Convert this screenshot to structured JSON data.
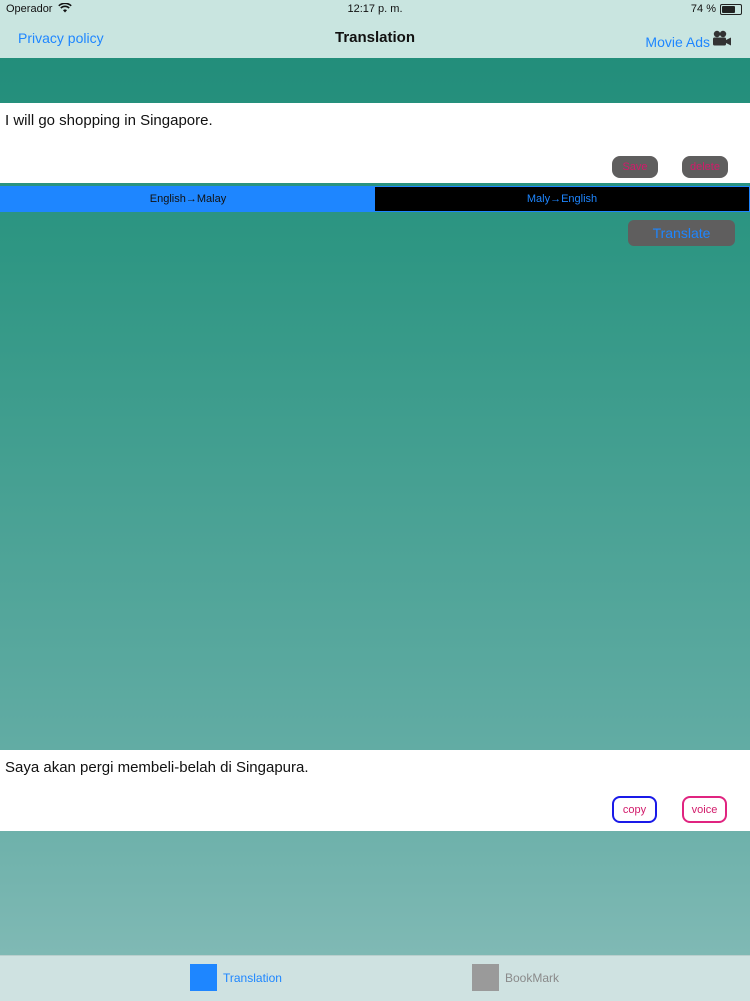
{
  "status": {
    "carrier": "Operador",
    "time": "12:17 p. m.",
    "battery": "74 %",
    "battery_level": 0.74
  },
  "nav": {
    "left_link": "Privacy policy",
    "title": "Translation",
    "right_link": "Movie Ads",
    "right_icon": "movie-camera-icon"
  },
  "input": {
    "text": "I will go shopping in Singapore.",
    "save_label": "Save",
    "delete_label": "delete"
  },
  "direction": {
    "options": [
      "English→Malay",
      "Maly→English"
    ],
    "selected": 0
  },
  "translate_label": "Translate",
  "output": {
    "text": "Saya akan pergi membeli-belah di Singapura.",
    "copy_label": "copy",
    "voice_label": "voice"
  },
  "tabs": [
    {
      "label": "Translation",
      "active": true
    },
    {
      "label": "BookMark",
      "active": false
    }
  ],
  "colors": {
    "accent": "#1e86ff",
    "header_bg": "#c9e5e0",
    "pink": "#d21a6a"
  }
}
